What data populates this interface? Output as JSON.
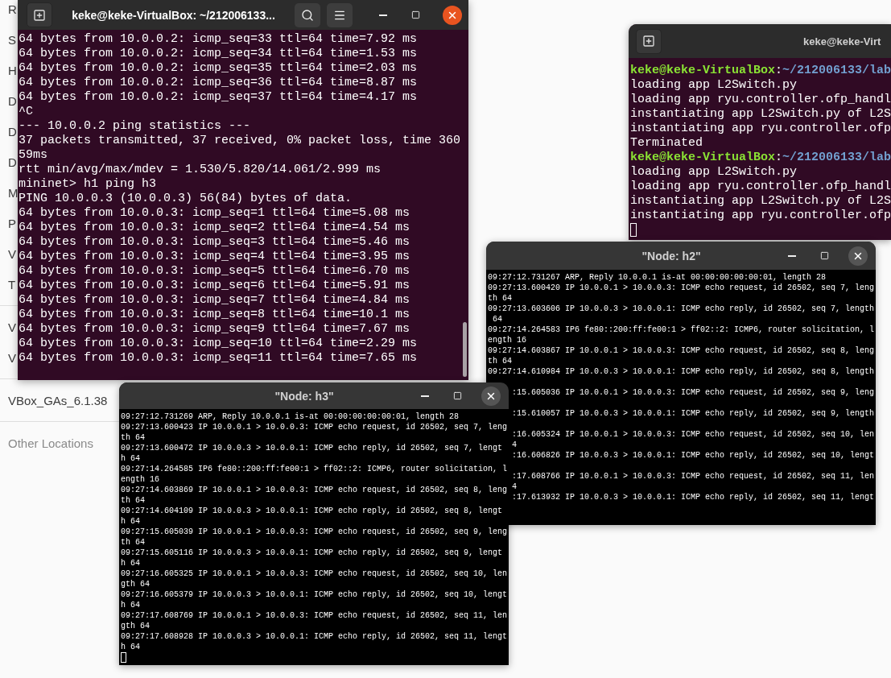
{
  "file_manager": {
    "sidebar_groups": [
      {
        "items": [
          {
            "label": "R",
            "kind": "place"
          },
          {
            "label": "S",
            "kind": "place"
          },
          {
            "label": "H",
            "kind": "place"
          },
          {
            "label": "D",
            "kind": "place"
          },
          {
            "label": "D",
            "kind": "place"
          },
          {
            "label": "D",
            "kind": "place"
          },
          {
            "label": "M",
            "kind": "place"
          },
          {
            "label": "P",
            "kind": "place"
          },
          {
            "label": "V",
            "kind": "place"
          },
          {
            "label": "T",
            "kind": "place"
          }
        ]
      },
      {
        "items": [
          {
            "label": "V",
            "kind": "place"
          },
          {
            "label": "V",
            "kind": "place"
          }
        ]
      },
      {
        "items": [
          {
            "label": "VBox_GAs_6.1.38",
            "kind": "place"
          }
        ]
      },
      {
        "items": [
          {
            "label": "Other Locations",
            "kind": "other"
          }
        ]
      }
    ]
  },
  "terminal": {
    "title": "keke@keke-VirtualBox: ~/212006133...",
    "active": true,
    "scrollbar": true,
    "lines": [
      "64 bytes from 10.0.0.2: icmp_seq=33 ttl=64 time=7.92 ms",
      "64 bytes from 10.0.0.2: icmp_seq=34 ttl=64 time=1.53 ms",
      "64 bytes from 10.0.0.2: icmp_seq=35 ttl=64 time=2.03 ms",
      "64 bytes from 10.0.0.2: icmp_seq=36 ttl=64 time=8.87 ms",
      "64 bytes from 10.0.0.2: icmp_seq=37 ttl=64 time=4.17 ms",
      "^C",
      "--- 10.0.0.2 ping statistics ---",
      "37 packets transmitted, 37 received, 0% packet loss, time 360",
      "59ms",
      "rtt min/avg/max/mdev = 1.530/5.820/14.061/2.999 ms",
      "mininet> h1 ping h3",
      "PING 10.0.0.3 (10.0.0.3) 56(84) bytes of data.",
      "64 bytes from 10.0.0.3: icmp_seq=1 ttl=64 time=5.08 ms",
      "64 bytes from 10.0.0.3: icmp_seq=2 ttl=64 time=4.54 ms",
      "64 bytes from 10.0.0.3: icmp_seq=3 ttl=64 time=5.46 ms",
      "64 bytes from 10.0.0.3: icmp_seq=4 ttl=64 time=3.95 ms",
      "64 bytes from 10.0.0.3: icmp_seq=5 ttl=64 time=6.70 ms",
      "64 bytes from 10.0.0.3: icmp_seq=6 ttl=64 time=5.91 ms",
      "64 bytes from 10.0.0.3: icmp_seq=7 ttl=64 time=4.84 ms",
      "64 bytes from 10.0.0.3: icmp_seq=8 ttl=64 time=10.1 ms",
      "64 bytes from 10.0.0.3: icmp_seq=9 ttl=64 time=7.67 ms",
      "64 bytes from 10.0.0.3: icmp_seq=10 ttl=64 time=2.29 ms",
      "64 bytes from 10.0.0.3: icmp_seq=11 ttl=64 time=7.65 ms"
    ]
  },
  "terminal_2": {
    "title": "keke@keke-Virt",
    "active": false,
    "cursor": true,
    "lines": [
      {
        "kind": "prompt",
        "user": "keke@keke-VirtualBox",
        "sep": ":",
        "path": "~/212006133/lab"
      },
      {
        "kind": "output",
        "text": "loading app L2Switch.py"
      },
      {
        "kind": "output",
        "text": "loading app ryu.controller.ofp_handl"
      },
      {
        "kind": "output",
        "text": "instantiating app L2Switch.py of L2S"
      },
      {
        "kind": "output",
        "text": "instantiating app ryu.controller.ofp"
      },
      {
        "kind": "output",
        "text": "Terminated"
      },
      {
        "kind": "prompt",
        "user": "keke@keke-VirtualBox",
        "sep": ":",
        "path": "~/212006133/lab"
      },
      {
        "kind": "output",
        "text": "loading app L2Switch.py"
      },
      {
        "kind": "output",
        "text": "loading app ryu.controller.ofp_handl"
      },
      {
        "kind": "output",
        "text": "instantiating app L2Switch.py of L2S"
      },
      {
        "kind": "output",
        "text": "instantiating app ryu.controller.ofp"
      }
    ]
  },
  "node_h2": {
    "title": "\"Node: h2\"",
    "active": false,
    "lines": [
      "09:27:12.731267 ARP, Reply 10.0.0.1 is-at 00:00:00:00:00:01, length 28",
      "09:27:13.600420 IP 10.0.0.1 > 10.0.0.3: ICMP echo request, id 26502, seq 7, leng",
      "th 64",
      "09:27:13.603606 IP 10.0.0.3 > 10.0.0.1: ICMP echo reply, id 26502, seq 7, length",
      " 64",
      "09:27:14.264583 IP6 fe80::200:ff:fe00:1 > ff02::2: ICMP6, router solicitation, l",
      "ength 16",
      "09:27:14.603867 IP 10.0.0.1 > 10.0.0.3: ICMP echo request, id 26502, seq 8, leng",
      "th 64",
      "09:27:14.610984 IP 10.0.0.3 > 10.0.0.1: ICMP echo reply, id 26502, seq 8, length"
    ],
    "covered_entries": [
      {
        "text": ":15.605036 IP 10.0.0.1 > 10.0.0.3: ICMP echo request, id 26502, seq 9, leng"
      },
      {
        "text": ":15.610057 IP 10.0.0.3 > 10.0.0.1: ICMP echo reply, id 26502, seq 9, length"
      },
      {
        "text": ":16.605324 IP 10.0.0.1 > 10.0.0.3: ICMP echo request, id 26502, seq 10, len",
        "continuation": "4"
      },
      {
        "text": ":16.606826 IP 10.0.0.3 > 10.0.0.1: ICMP echo reply, id 26502, seq 10, lengt"
      },
      {
        "text": ":17.608766 IP 10.0.0.1 > 10.0.0.3: ICMP echo request, id 26502, seq 11, len",
        "continuation": "4"
      },
      {
        "text": ":17.613932 IP 10.0.0.3 > 10.0.0.1: ICMP echo reply, id 26502, seq 11, lengt"
      }
    ]
  },
  "node_h3": {
    "title": "\"Node: h3\"",
    "active": false,
    "cursor": true,
    "entries": [
      "09:27:12.731269 ARP, Reply 10.0.0.1 is-at 00:00:00:00:00:01, length 28",
      "09:27:13.600423 IP 10.0.0.1 > 10.0.0.3: ICMP echo request, id 26502, seq 7, length 64",
      "09:27:13.600472 IP 10.0.0.3 > 10.0.0.1: ICMP echo reply, id 26502, seq 7, length 64",
      "09:27:14.264585 IP6 fe80::200:ff:fe00:1 > ff02::2: ICMP6, router solicitation, length 16",
      "09:27:14.603869 IP 10.0.0.1 > 10.0.0.3: ICMP echo request, id 26502, seq 8, length 64",
      "09:27:14.604109 IP 10.0.0.3 > 10.0.0.1: ICMP echo reply, id 26502, seq 8, length 64",
      "09:27:15.605039 IP 10.0.0.1 > 10.0.0.3: ICMP echo request, id 26502, seq 9, length 64",
      "09:27:15.605116 IP 10.0.0.3 > 10.0.0.1: ICMP echo reply, id 26502, seq 9, length 64",
      "09:27:16.605325 IP 10.0.0.1 > 10.0.0.3: ICMP echo request, id 26502, seq 10, length 64",
      "09:27:16.605379 IP 10.0.0.3 > 10.0.0.1: ICMP echo reply, id 26502, seq 10, length 64",
      "09:27:17.608769 IP 10.0.0.1 > 10.0.0.3: ICMP echo request, id 26502, seq 11, length 64",
      "09:27:17.608928 IP 10.0.0.3 > 10.0.0.1: ICMP echo reply, id 26502, seq 11, length 64"
    ]
  }
}
